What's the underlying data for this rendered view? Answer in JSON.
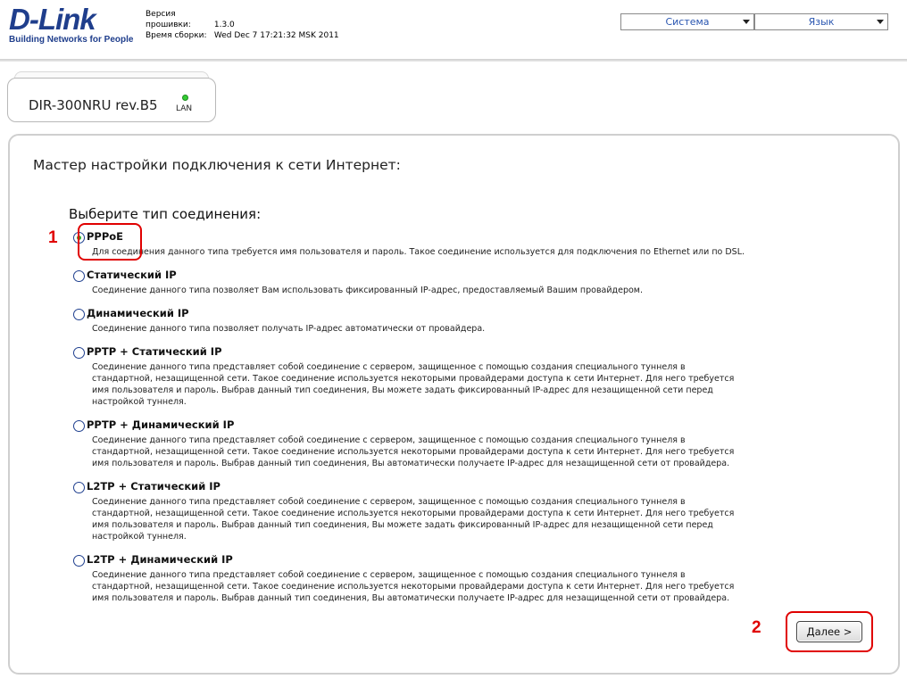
{
  "header": {
    "logo_text": "D-Link",
    "logo_tagline": "Building Networks for People",
    "firmware_label": "Версия прошивки:",
    "firmware_value": "1.3.0",
    "build_label": "Время сборки:",
    "build_value": "Wed Dec 7 17:21:32 MSK 2011",
    "menu_system": "Система",
    "menu_language": "Язык"
  },
  "device": {
    "name": "DIR-300NRU rev.B5",
    "lan_label": "LAN"
  },
  "wizard": {
    "title": "Мастер настройки подключения к сети Интернет:",
    "section_title": "Выберите тип соединения:",
    "options": [
      {
        "label": "PPPoE",
        "checked": true,
        "desc": "Для соединения данного типа требуется имя пользователя и пароль. Такое соединение используется для подключения по Ethernet или по DSL."
      },
      {
        "label": "Статический IP",
        "checked": false,
        "desc": "Соединение данного типа позволяет Вам использовать фиксированный IP-адрес, предоставляемый Вашим провайдером."
      },
      {
        "label": "Динамический IP",
        "checked": false,
        "desc": "Соединение данного типа позволяет получать IP-адрес автоматически от провайдера."
      },
      {
        "label": "PPTP + Статический IP",
        "checked": false,
        "desc": "Соединение данного типа представляет собой соединение с сервером, защищенное с помощью создания специального туннеля в стандартной, незащищенной сети. Такое соединение используется некоторыми провайдерами доступа к сети Интернет. Для него требуется имя пользователя и пароль. Выбрав данный тип соединения, Вы можете задать фиксированный IP-адрес для незащищенной сети перед настройкой туннеля."
      },
      {
        "label": "PPTP + Динамический IP",
        "checked": false,
        "desc": "Соединение данного типа представляет собой соединение с сервером, защищенное с помощью создания специального туннеля в стандартной, незащищенной сети. Такое соединение используется некоторыми провайдерами доступа к сети Интернет. Для него требуется имя пользователя и пароль. Выбрав данный тип соединения, Вы автоматически получаете IP-адрес для незащищенной сети от провайдера."
      },
      {
        "label": "L2TP + Статический IP",
        "checked": false,
        "desc": "Соединение данного типа представляет собой соединение с сервером, защищенное с помощью создания специального туннеля в стандартной, незащищенной сети. Такое соединение используется некоторыми провайдерами доступа к сети Интернет. Для него требуется имя пользователя и пароль. Выбрав данный тип соединения, Вы можете задать фиксированный IP-адрес для незащищенной сети перед настройкой туннеля."
      },
      {
        "label": "L2TP + Динамический IP",
        "checked": false,
        "desc": "Соединение данного типа представляет собой соединение с сервером, защищенное с помощью создания специального туннеля в стандартной, незащищенной сети. Такое соединение используется некоторыми провайдерами доступа к сети Интернет. Для него требуется имя пользователя и пароль. Выбрав данный тип соединения, Вы автоматически получаете IP-адрес для незащищенной сети от провайдера."
      }
    ],
    "next_button": "Далее >"
  },
  "annotations": {
    "marker_1": "1",
    "marker_2": "2",
    "color": "#e00000"
  },
  "colors": {
    "brand": "#1f3e8c",
    "menu_text": "#2a56b0",
    "radio_checked": "#3aa82f"
  }
}
